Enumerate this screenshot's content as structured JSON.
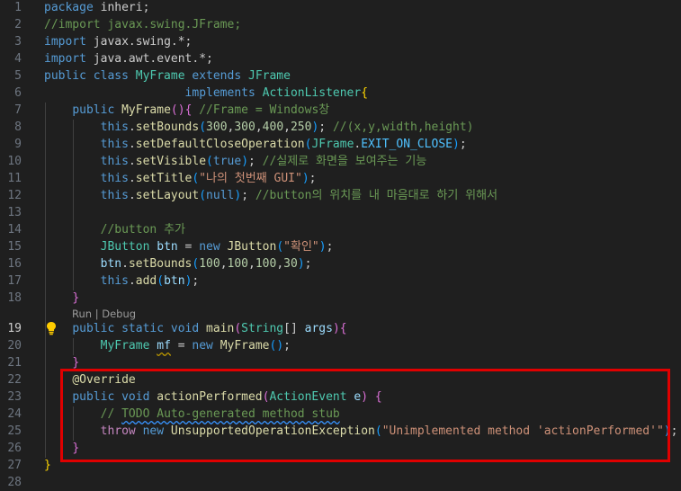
{
  "editor": {
    "codelens": {
      "run": "Run",
      "separator": " | ",
      "debug": "Debug"
    },
    "active_line": "19",
    "lines": [
      {
        "n": "1",
        "t": [
          [
            "kw",
            "package "
          ],
          [
            "pl",
            "inheri;"
          ]
        ]
      },
      {
        "n": "2",
        "t": [
          [
            "cm",
            "//import javax.swing.JFrame;"
          ]
        ]
      },
      {
        "n": "3",
        "t": [
          [
            "kw",
            "import "
          ],
          [
            "pl",
            "javax.swing.*;"
          ]
        ]
      },
      {
        "n": "4",
        "t": [
          [
            "kw",
            "import "
          ],
          [
            "pl",
            "java.awt.event.*;"
          ]
        ]
      },
      {
        "n": "5",
        "t": [
          [
            "kw",
            "public class "
          ],
          [
            "ty",
            "MyFrame "
          ],
          [
            "kw",
            "extends "
          ],
          [
            "ty",
            "JFrame"
          ]
        ]
      },
      {
        "n": "6",
        "t": [
          [
            "pl",
            "                    "
          ],
          [
            "kw",
            "implements "
          ],
          [
            "ty",
            "ActionListener"
          ],
          [
            "br1",
            "{"
          ]
        ]
      },
      {
        "n": "7",
        "t": [
          [
            "pl",
            "    "
          ],
          [
            "kw",
            "public "
          ],
          [
            "fn",
            "MyFrame"
          ],
          [
            "br2",
            "()"
          ],
          [
            "br2",
            "{ "
          ],
          [
            "cm",
            "//Frame = Windows창"
          ]
        ]
      },
      {
        "n": "8",
        "t": [
          [
            "pl",
            "        "
          ],
          [
            "kw",
            "this"
          ],
          [
            "pl",
            "."
          ],
          [
            "fn",
            "setBounds"
          ],
          [
            "br3",
            "("
          ],
          [
            "nu",
            "300"
          ],
          [
            "pl",
            ","
          ],
          [
            "nu",
            "300"
          ],
          [
            "pl",
            ","
          ],
          [
            "nu",
            "400"
          ],
          [
            "pl",
            ","
          ],
          [
            "nu",
            "250"
          ],
          [
            "br3",
            ")"
          ],
          [
            "pl",
            "; "
          ],
          [
            "cm",
            "//(x,y,width,height)"
          ]
        ]
      },
      {
        "n": "9",
        "t": [
          [
            "pl",
            "        "
          ],
          [
            "kw",
            "this"
          ],
          [
            "pl",
            "."
          ],
          [
            "fn",
            "setDefaultCloseOperation"
          ],
          [
            "br3",
            "("
          ],
          [
            "ty",
            "JFrame"
          ],
          [
            "pl",
            "."
          ],
          [
            "cn",
            "EXIT_ON_CLOSE"
          ],
          [
            "br3",
            ")"
          ],
          [
            "pl",
            ";"
          ]
        ]
      },
      {
        "n": "10",
        "t": [
          [
            "pl",
            "        "
          ],
          [
            "kw",
            "this"
          ],
          [
            "pl",
            "."
          ],
          [
            "fn",
            "setVisible"
          ],
          [
            "br3",
            "("
          ],
          [
            "kw",
            "true"
          ],
          [
            "br3",
            ")"
          ],
          [
            "pl",
            "; "
          ],
          [
            "cm",
            "//실제로 화면을 보여주는 기능"
          ]
        ]
      },
      {
        "n": "11",
        "t": [
          [
            "pl",
            "        "
          ],
          [
            "kw",
            "this"
          ],
          [
            "pl",
            "."
          ],
          [
            "fn",
            "setTitle"
          ],
          [
            "br3",
            "("
          ],
          [
            "st",
            "\"나의 첫번째 GUI\""
          ],
          [
            "br3",
            ")"
          ],
          [
            "pl",
            ";"
          ]
        ]
      },
      {
        "n": "12",
        "t": [
          [
            "pl",
            "        "
          ],
          [
            "kw",
            "this"
          ],
          [
            "pl",
            "."
          ],
          [
            "fn",
            "setLayout"
          ],
          [
            "br3",
            "("
          ],
          [
            "kw",
            "null"
          ],
          [
            "br3",
            ")"
          ],
          [
            "pl",
            "; "
          ],
          [
            "cm",
            "//button의 위치를 내 마음대로 하기 위해서"
          ]
        ]
      },
      {
        "n": "13",
        "t": []
      },
      {
        "n": "14",
        "t": [
          [
            "pl",
            "        "
          ],
          [
            "cm",
            "//button 추가"
          ]
        ]
      },
      {
        "n": "15",
        "t": [
          [
            "pl",
            "        "
          ],
          [
            "ty",
            "JButton "
          ],
          [
            "va",
            "btn"
          ],
          [
            "pl",
            " = "
          ],
          [
            "kw",
            "new "
          ],
          [
            "fn",
            "JButton"
          ],
          [
            "br3",
            "("
          ],
          [
            "st",
            "\"확인\""
          ],
          [
            "br3",
            ")"
          ],
          [
            "pl",
            ";"
          ]
        ]
      },
      {
        "n": "16",
        "t": [
          [
            "pl",
            "        "
          ],
          [
            "va",
            "btn"
          ],
          [
            "pl",
            "."
          ],
          [
            "fn",
            "setBounds"
          ],
          [
            "br3",
            "("
          ],
          [
            "nu",
            "100"
          ],
          [
            "pl",
            ","
          ],
          [
            "nu",
            "100"
          ],
          [
            "pl",
            ","
          ],
          [
            "nu",
            "100"
          ],
          [
            "pl",
            ","
          ],
          [
            "nu",
            "30"
          ],
          [
            "br3",
            ")"
          ],
          [
            "pl",
            ";"
          ]
        ]
      },
      {
        "n": "17",
        "t": [
          [
            "pl",
            "        "
          ],
          [
            "kw",
            "this"
          ],
          [
            "pl",
            "."
          ],
          [
            "fn",
            "add"
          ],
          [
            "br3",
            "("
          ],
          [
            "va",
            "btn"
          ],
          [
            "br3",
            ")"
          ],
          [
            "pl",
            ";"
          ]
        ]
      },
      {
        "n": "18",
        "t": [
          [
            "pl",
            "    "
          ],
          [
            "br2",
            "}"
          ]
        ]
      },
      {
        "n": "19",
        "t": [
          [
            "pl",
            "    "
          ],
          [
            "kw",
            "public static void "
          ],
          [
            "fn",
            "main"
          ],
          [
            "br2",
            "("
          ],
          [
            "ty",
            "String"
          ],
          [
            "pl",
            "[] "
          ],
          [
            "va",
            "args"
          ],
          [
            "br2",
            ")"
          ],
          [
            "br2",
            "{"
          ]
        ]
      },
      {
        "n": "20",
        "t": [
          [
            "pl",
            "        "
          ],
          [
            "ty",
            "MyFrame "
          ],
          [
            "va squig",
            "mf"
          ],
          [
            "pl",
            " = "
          ],
          [
            "kw",
            "new "
          ],
          [
            "fn",
            "MyFrame"
          ],
          [
            "br3",
            "()"
          ],
          [
            "pl",
            ";"
          ]
        ]
      },
      {
        "n": "21",
        "t": [
          [
            "pl",
            "    "
          ],
          [
            "br2",
            "}"
          ]
        ]
      },
      {
        "n": "22",
        "t": [
          [
            "pl",
            "    "
          ],
          [
            "an",
            "@Override"
          ]
        ]
      },
      {
        "n": "23",
        "t": [
          [
            "pl",
            "    "
          ],
          [
            "kw",
            "public void "
          ],
          [
            "fn",
            "actionPerformed"
          ],
          [
            "br2",
            "("
          ],
          [
            "ty",
            "ActionEvent "
          ],
          [
            "va",
            "e"
          ],
          [
            "br2",
            ") "
          ],
          [
            "br2",
            "{"
          ]
        ]
      },
      {
        "n": "24",
        "t": [
          [
            "pl",
            "        "
          ],
          [
            "cm",
            "// "
          ],
          [
            "cm squig2",
            "TODO Auto-generated method stub"
          ]
        ]
      },
      {
        "n": "25",
        "t": [
          [
            "pl",
            "        "
          ],
          [
            "kwc",
            "throw "
          ],
          [
            "kw",
            "new "
          ],
          [
            "fn",
            "UnsupportedOperationException"
          ],
          [
            "br3",
            "("
          ],
          [
            "st",
            "\"Unimplemented method 'actionPerformed'\""
          ],
          [
            "br3",
            ")"
          ],
          [
            "pl",
            ";"
          ]
        ]
      },
      {
        "n": "26",
        "t": [
          [
            "pl",
            "    "
          ],
          [
            "br2",
            "}"
          ]
        ]
      },
      {
        "n": "27",
        "t": [
          [
            "br1",
            "}"
          ]
        ]
      },
      {
        "n": "28",
        "t": []
      }
    ]
  }
}
